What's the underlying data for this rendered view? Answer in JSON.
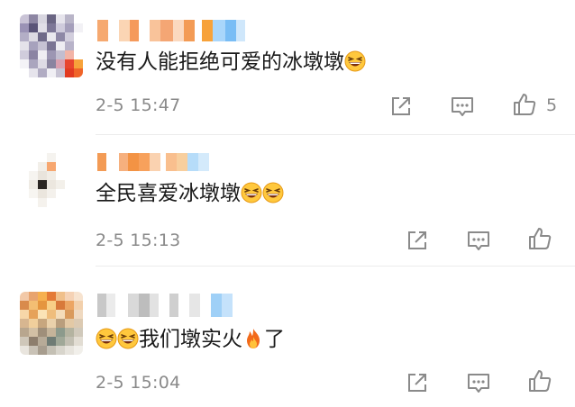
{
  "comments": [
    {
      "text": "没有人能拒绝可爱的冰墩墩",
      "emoji_after": [
        "grin-squint-emoji"
      ],
      "timestamp": "2-5 15:47",
      "likes": "5"
    },
    {
      "text": "全民喜爱冰墩墩",
      "emoji_after": [
        "grin-squint-emoji",
        "grin-squint-emoji"
      ],
      "timestamp": "2-5 15:13",
      "likes": ""
    },
    {
      "emoji_before": [
        "grin-squint-emoji",
        "grin-squint-emoji"
      ],
      "text": "我们墩实火",
      "mid_emoji": "fire-emoji",
      "text_after": "了",
      "timestamp": "2-5 15:04",
      "likes": ""
    }
  ],
  "icons": {
    "share": "share-icon",
    "comment": "comment-icon",
    "like": "thumbs-up-icon"
  },
  "colors": {
    "text": "#1a1a1a",
    "meta": "#8a8a8a",
    "icon": "#8a8a8a",
    "divider": "#ececec"
  }
}
